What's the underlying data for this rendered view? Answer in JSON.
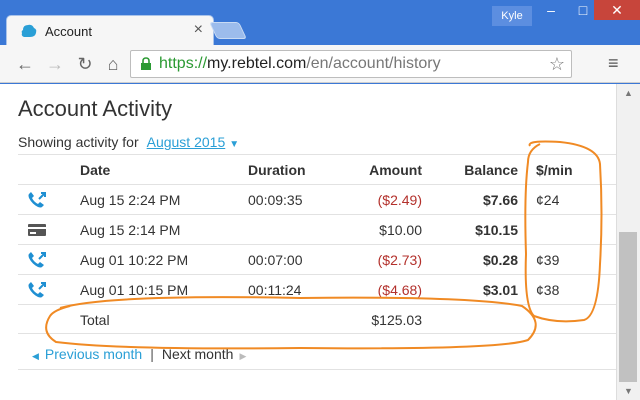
{
  "browser": {
    "tab_title": "Account",
    "tab_close": "×",
    "user_name": "Kyle",
    "url_scheme": "https://",
    "url_host": "my.rebtel.com",
    "url_path": "/en/account/history",
    "window_controls": {
      "min": "–",
      "max": "□",
      "close": "✕"
    }
  },
  "page": {
    "title": "Account Activity",
    "showing_label": "Showing activity for",
    "month": "August 2015",
    "columns": {
      "date": "Date",
      "duration": "Duration",
      "amount": "Amount",
      "balance": "Balance",
      "rate": "$/min"
    },
    "rows": [
      {
        "type": "call",
        "date": "Aug 15 2:24 PM",
        "duration": "00:09:35",
        "amount": "($2.49)",
        "balance": "$7.66",
        "rate": "¢24"
      },
      {
        "type": "payment",
        "date": "Aug 15 2:14 PM",
        "duration": "",
        "amount": "$10.00",
        "balance": "$10.15",
        "rate": ""
      },
      {
        "type": "call",
        "date": "Aug 01 10:22 PM",
        "duration": "00:07:00",
        "amount": "($2.73)",
        "balance": "$0.28",
        "rate": "¢39"
      },
      {
        "type": "call",
        "date": "Aug 01 10:15 PM",
        "duration": "00:11:24",
        "amount": "($4.68)",
        "balance": "$3.01",
        "rate": "¢38"
      }
    ],
    "total_label": "Total",
    "total_amount": "$125.03",
    "prev_month": "Previous month",
    "pager_sep": "|",
    "next_month": "Next month"
  },
  "colors": {
    "link": "#2a9fd6",
    "negative": "#b3312c",
    "annotation": "#f08a24",
    "tab_favicon": "#2a9fd6"
  },
  "icons": {
    "call": "outgoing-call-icon",
    "payment": "card-payment-icon"
  }
}
